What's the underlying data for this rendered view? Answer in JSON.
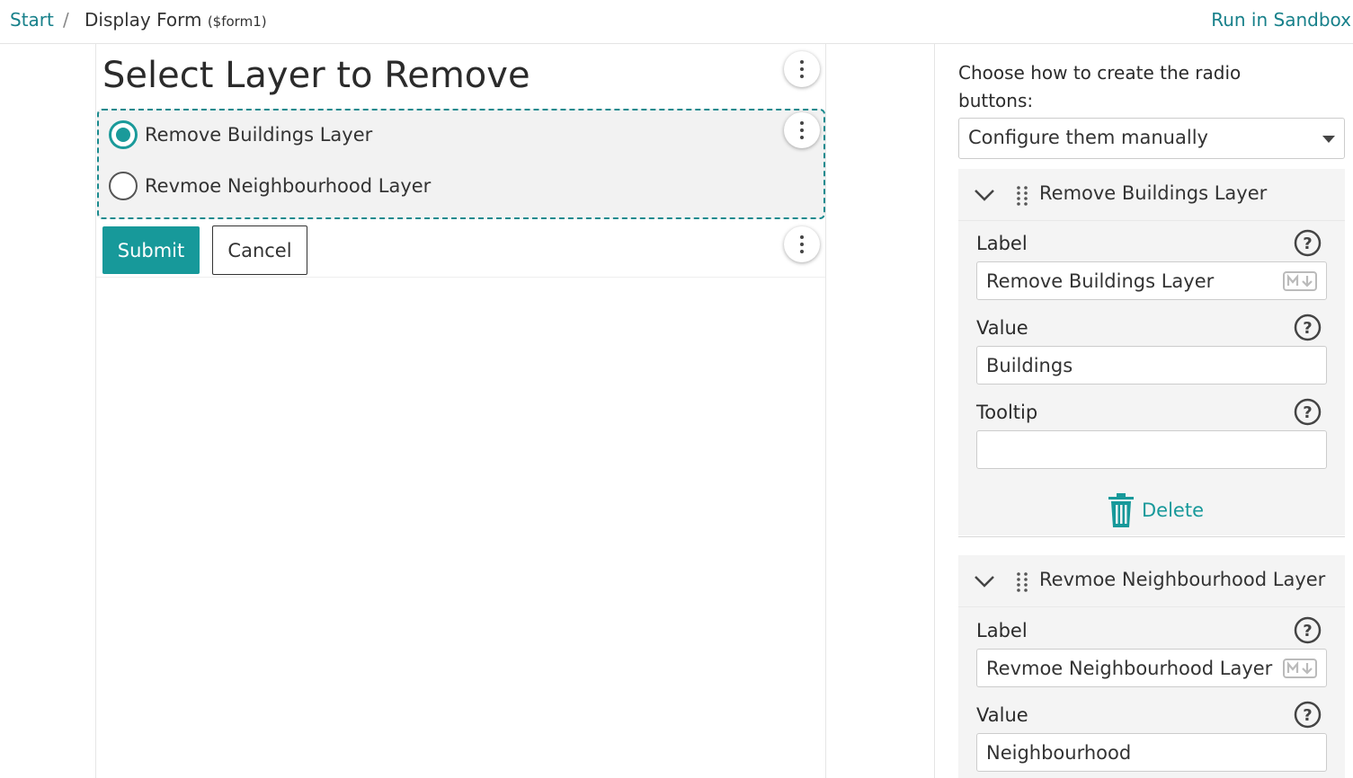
{
  "header": {
    "breadcrumb_start": "Start",
    "breadcrumb_separator": "/",
    "breadcrumb_current": "Display Form",
    "breadcrumb_current_id": "($form1)",
    "run_sandbox": "Run in Sandbox"
  },
  "form": {
    "title": "Select Layer to Remove",
    "radio_options": [
      {
        "label": "Remove Buildings Layer",
        "checked": true
      },
      {
        "label": "Revmoe Neighbourhood Layer",
        "checked": false
      }
    ],
    "submit_label": "Submit",
    "cancel_label": "Cancel"
  },
  "panel": {
    "prompt": "Choose how to create the radio buttons:",
    "mode_selected": "Configure them manually",
    "items": [
      {
        "title": "Remove Buildings Layer",
        "label_caption": "Label",
        "label_value": "Remove Buildings Layer",
        "value_caption": "Value",
        "value_value": "Buildings",
        "tooltip_caption": "Tooltip",
        "tooltip_value": "",
        "delete_label": "Delete"
      },
      {
        "title": "Revmoe Neighbourhood Layer",
        "label_caption": "Label",
        "label_value": "Revmoe Neighbourhood Layer",
        "value_caption": "Value",
        "value_value": "Neighbourhood"
      }
    ]
  },
  "colors": {
    "accent": "#17999a",
    "link": "#17808a"
  },
  "icons": {
    "kebab": "kebab-menu-icon",
    "chevron": "chevron-down-icon",
    "grip": "drag-handle-icon",
    "help": "help-icon",
    "markdown": "markdown-icon",
    "trash": "trash-icon",
    "caret": "caret-down-icon"
  }
}
